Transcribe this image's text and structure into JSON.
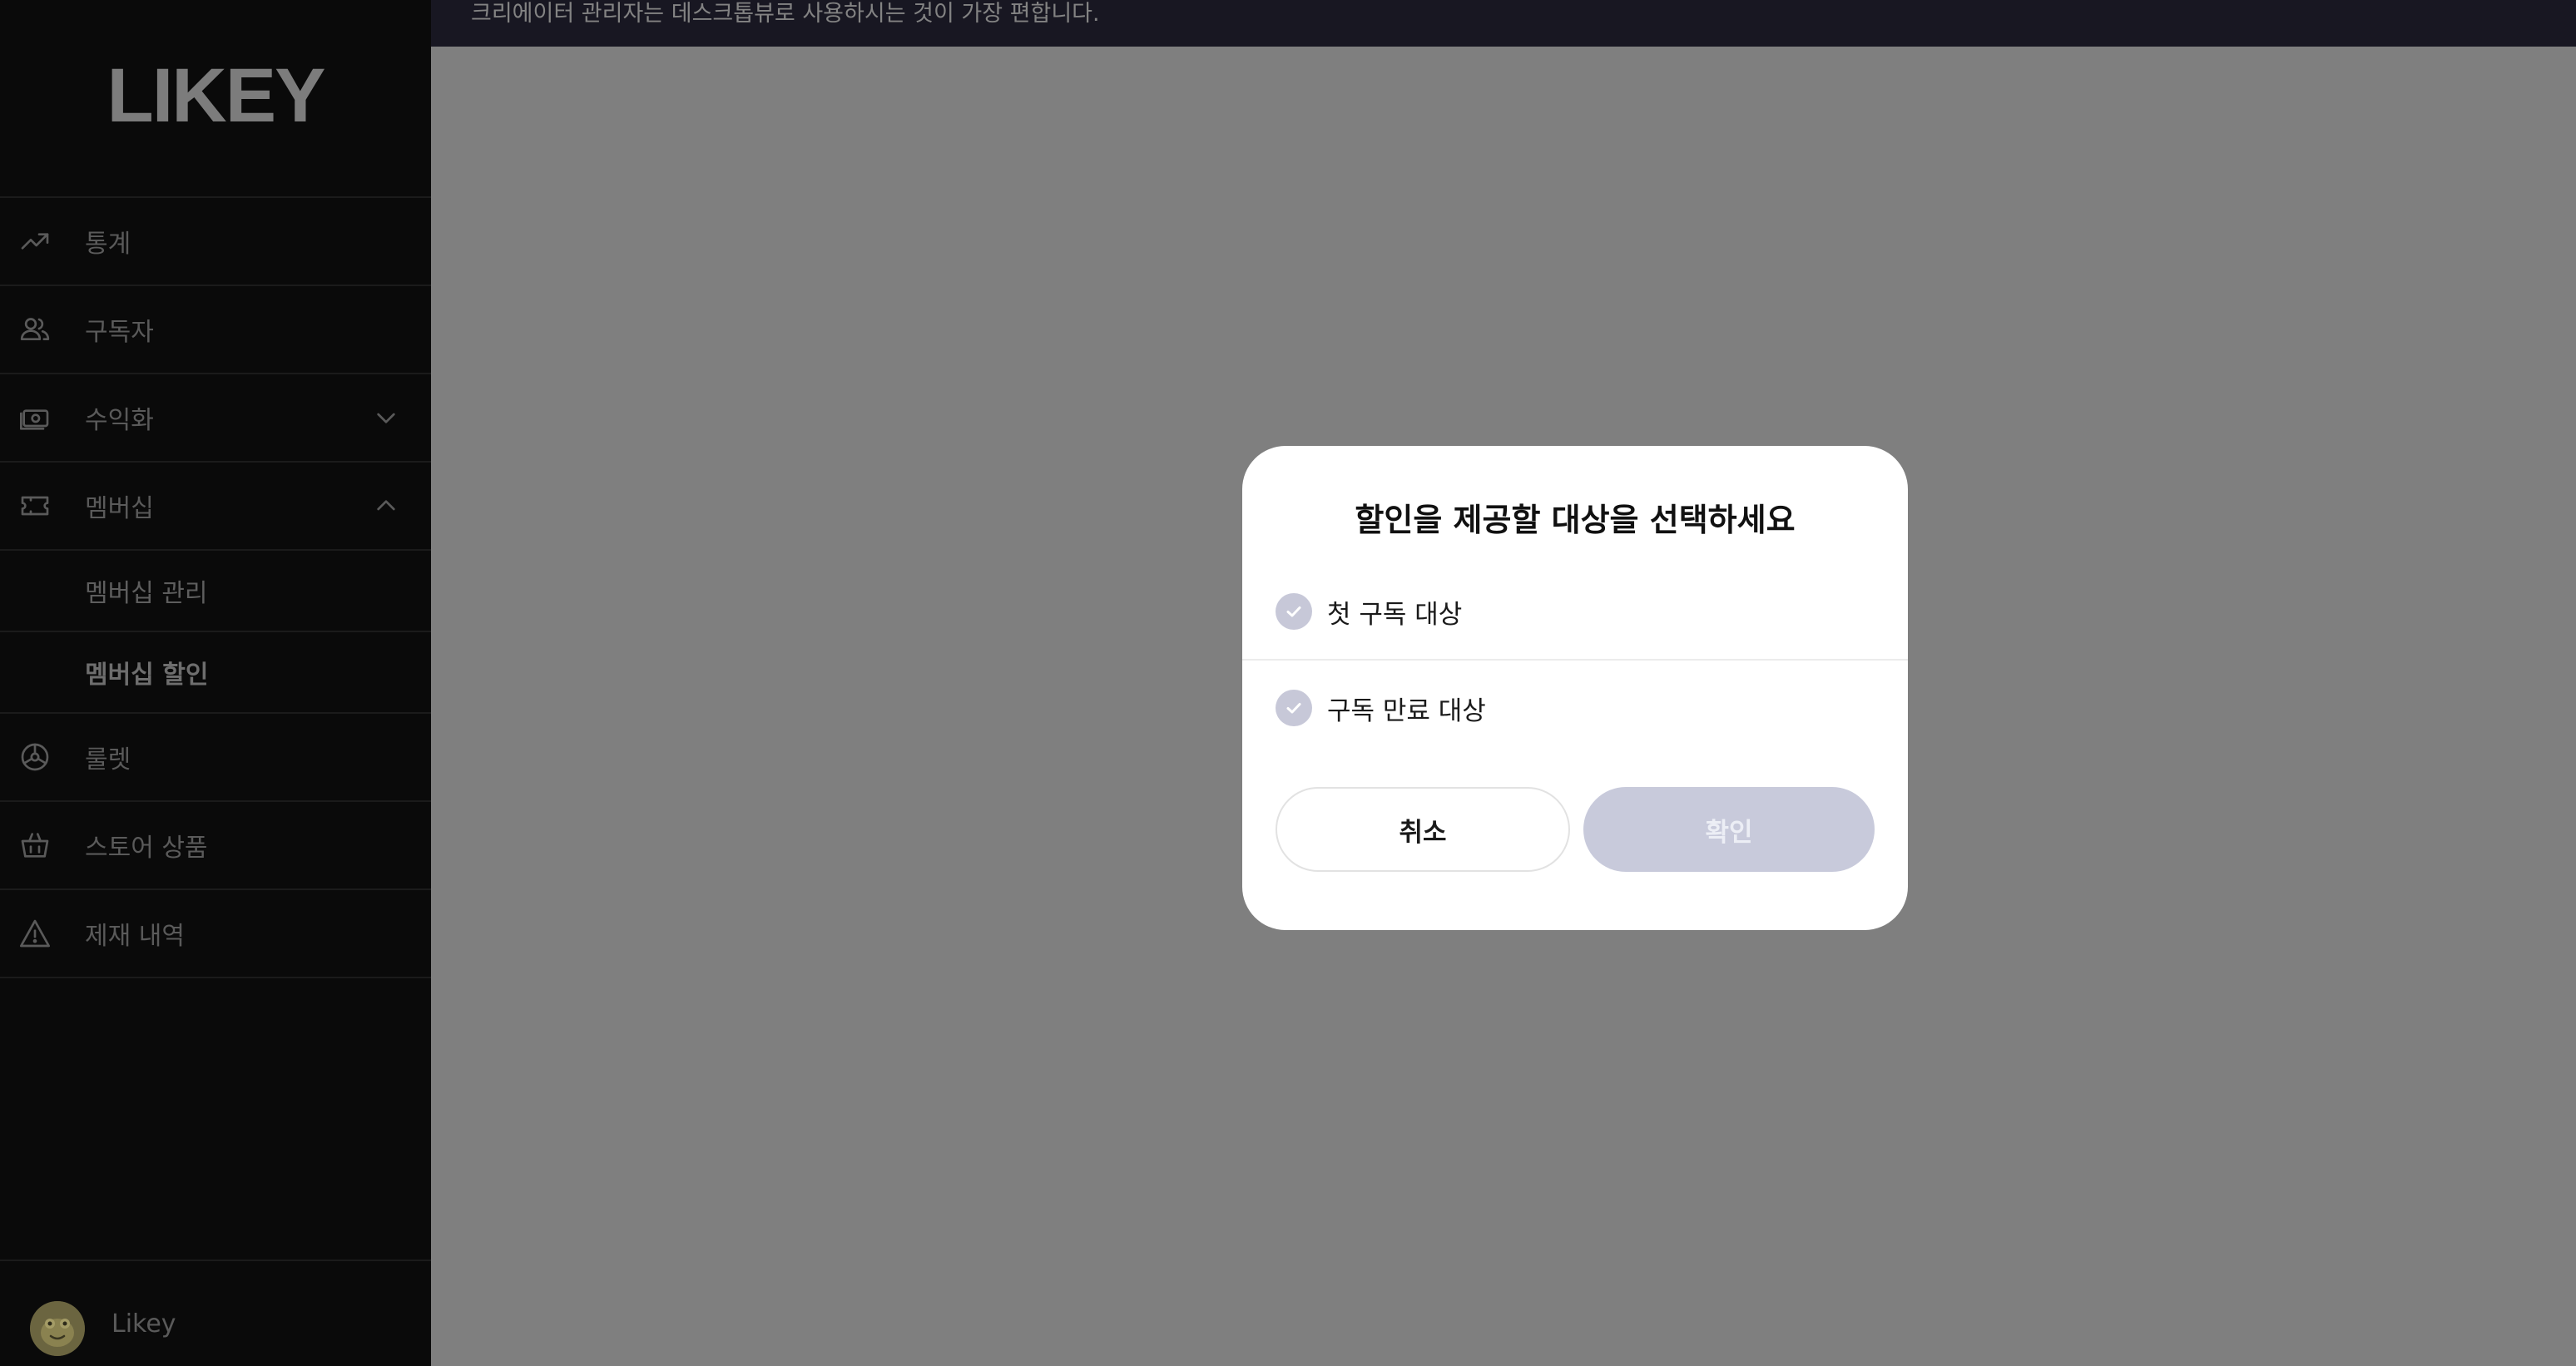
{
  "app": {
    "logo": "LIKEY"
  },
  "notice": {
    "text": "크리에이터 관리자는 데스크톱뷰로 사용하시는 것이 가장 편합니다."
  },
  "sidebar": {
    "items": [
      {
        "label": "통계",
        "icon": "trending-up-icon"
      },
      {
        "label": "구독자",
        "icon": "users-icon"
      },
      {
        "label": "수익화",
        "icon": "money-icon",
        "chevron": "down"
      },
      {
        "label": "멤버십",
        "icon": "ticket-icon",
        "chevron": "up"
      }
    ],
    "membership_sub": [
      {
        "label": "멤버십 관리"
      },
      {
        "label": "멤버십 할인",
        "active": true
      }
    ],
    "items_after": [
      {
        "label": "룰렛",
        "icon": "roulette-icon"
      },
      {
        "label": "스토어 상품",
        "icon": "basket-icon"
      },
      {
        "label": "제재 내역",
        "icon": "warning-icon"
      }
    ],
    "profile": {
      "name": "Likey"
    }
  },
  "modal": {
    "title": "할인을 제공할 대상을 선택하세요",
    "options": [
      {
        "label": "첫 구독 대상",
        "checked": false
      },
      {
        "label": "구독 만료 대상",
        "checked": false
      }
    ],
    "cancel_label": "취소",
    "confirm_label": "확인"
  },
  "colors": {
    "overlay": "#7f7f7f",
    "sidebar_bg": "#0a0a0a",
    "notice_bg": "#181722",
    "check_bg": "#c7c8d8",
    "confirm_disabled_bg": "#c8cadb"
  }
}
